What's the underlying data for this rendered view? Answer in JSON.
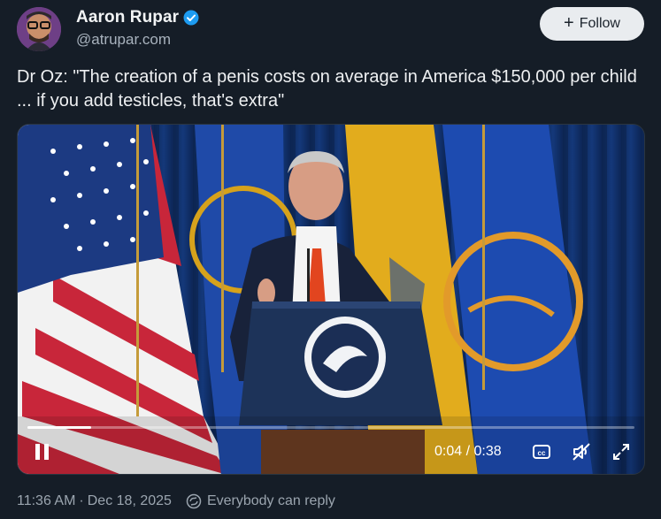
{
  "author": {
    "display_name": "Aaron Rupar",
    "handle": "@atrupar.com",
    "verified": true,
    "avatar_icon": "avatar"
  },
  "follow_button": {
    "label": "Follow",
    "icon": "plus-icon"
  },
  "post": {
    "text": "Dr Oz: \"The creation of a penis costs on average in America $150,000 per child ... if you add testicles, that's extra\""
  },
  "video": {
    "time_display": "0:04 / 0:38",
    "progress_fraction": 0.105,
    "controls": [
      "pause-icon",
      "closed-captions-icon",
      "mute-icon",
      "fullscreen-icon"
    ]
  },
  "footer": {
    "time": "11:36 AM",
    "separator": "·",
    "date": "Dec 18, 2025",
    "reply_setting": "Everybody can reply"
  },
  "colors": {
    "background": "#151d27",
    "follow_button_bg": "#e9ecef",
    "verified_badge": "#1d9bf0",
    "secondary_text": "#9ba5af"
  }
}
